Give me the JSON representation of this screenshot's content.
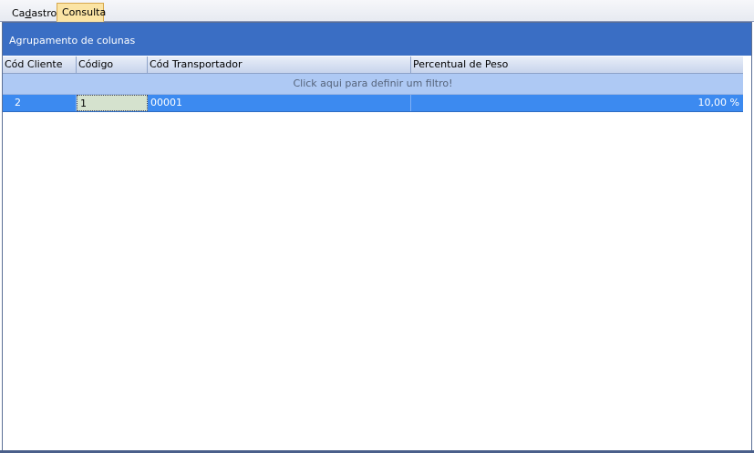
{
  "tabs": [
    {
      "label_pre": "Ca",
      "label_u": "d",
      "label_post": "astro",
      "active": false
    },
    {
      "label": "Consulta",
      "active": true
    }
  ],
  "group_panel": {
    "text": "Agrupamento de colunas"
  },
  "grid": {
    "columns": [
      "Cód Cliente",
      "Código",
      "Cód Transportador",
      "Percentual de Peso"
    ],
    "filter_text": "Click aqui para definir um filtro!",
    "rows": [
      {
        "cod_cliente": "2",
        "codigo": "1",
        "cod_transportador": "00001",
        "percentual_peso": "10,00 %"
      }
    ]
  },
  "colors": {
    "group_panel": "#3a6ec4",
    "selected_row": "#3c8af0",
    "filter_row": "#aec9f4",
    "active_tab": "#fbe4a4"
  }
}
